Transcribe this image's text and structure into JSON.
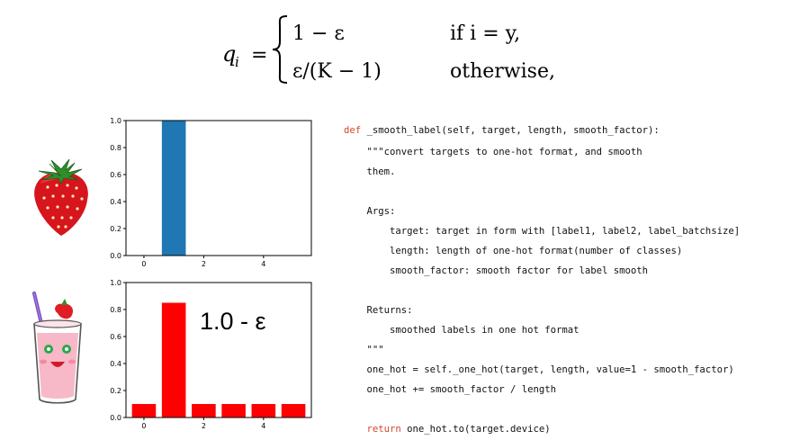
{
  "formula": {
    "lhs": "q",
    "lhs_sub": "i",
    "equals": "=",
    "case1_value": "1 − ε",
    "case1_cond": "if i = y,",
    "case2_value": "ε/(K − 1)",
    "case2_cond": "otherwise,"
  },
  "annotation": "1.0 - ε",
  "icons": {
    "top": "strawberry-icon",
    "bottom": "smoothie-icon"
  },
  "chart_data": [
    {
      "type": "bar",
      "x": [
        1
      ],
      "values": [
        1.0
      ],
      "color": "#1f77b4",
      "xlim": [
        -0.6,
        5.6
      ],
      "ylim": [
        0,
        1.0
      ],
      "xticks": [
        "0",
        "2",
        "4"
      ],
      "yticks": [
        "0.0",
        "0.2",
        "0.4",
        "0.6",
        "0.8",
        "1.0"
      ],
      "title": "",
      "xlabel": "",
      "ylabel": ""
    },
    {
      "type": "bar",
      "x": [
        0,
        1,
        2,
        3,
        4,
        5
      ],
      "values": [
        0.1,
        0.85,
        0.1,
        0.1,
        0.1,
        0.1
      ],
      "color": "#ff0000",
      "xlim": [
        -0.6,
        5.6
      ],
      "ylim": [
        0,
        1.0
      ],
      "xticks": [
        "0",
        "2",
        "4"
      ],
      "yticks": [
        "0.0",
        "0.2",
        "0.4",
        "0.6",
        "0.8",
        "1.0"
      ],
      "title": "",
      "xlabel": "",
      "ylabel": ""
    }
  ],
  "code": {
    "lines": [
      {
        "kw": "def",
        "text": " _smooth_label(self, target, length, smooth_factor):"
      },
      {
        "text": "    \"\"\"convert targets to one-hot format, and smooth"
      },
      {
        "text": "    them."
      },
      {
        "text": ""
      },
      {
        "text": "    Args:"
      },
      {
        "text": "        target: target in form with [label1, label2, label_batchsize]"
      },
      {
        "text": "        length: length of one-hot format(number of classes)"
      },
      {
        "text": "        smooth_factor: smooth factor for label smooth"
      },
      {
        "text": ""
      },
      {
        "text": "    Returns:"
      },
      {
        "text": "        smoothed labels in one hot format"
      },
      {
        "text": "    \"\"\""
      },
      {
        "text": "    one_hot = self._one_hot(target, length, value=1 - smooth_factor)"
      },
      {
        "text": "    one_hot += smooth_factor / length"
      },
      {
        "text": ""
      },
      {
        "kwIndent": "    ",
        "kw": "return",
        "text": " one_hot.to(target.device)"
      }
    ]
  }
}
